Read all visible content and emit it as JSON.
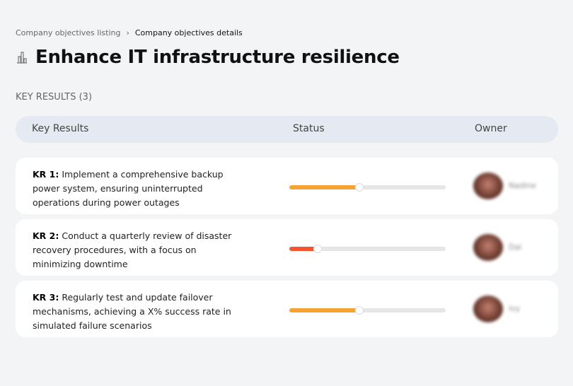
{
  "breadcrumb": {
    "parent": "Company objectives listing",
    "separator": "›",
    "current": "Company objectives details"
  },
  "page": {
    "title": "Enhance IT infrastructure resilience",
    "icon": "building-icon"
  },
  "key_results_label": "KEY RESULTS (3)",
  "table": {
    "headers": [
      "Key Results",
      "Status",
      "Owner"
    ]
  },
  "rows": [
    {
      "kr": "KR 1:",
      "text": "Implement a comprehensive backup power system, ensuring uninterrupted operations during power outages",
      "progress": 45,
      "color": "#f8a232",
      "owner": "Nadine"
    },
    {
      "kr": "KR 2:",
      "text": "Conduct a quarterly review of disaster recovery procedures, with a focus on minimizing downtime",
      "progress": 18,
      "color": "#f4552f",
      "owner": "Dai"
    },
    {
      "kr": "KR 3:",
      "text": "Regularly test and update failover mechanisms, achieving a X% success rate in simulated failure scenarios",
      "progress": 45,
      "color": "#f8a232",
      "owner": "Ivy"
    }
  ]
}
